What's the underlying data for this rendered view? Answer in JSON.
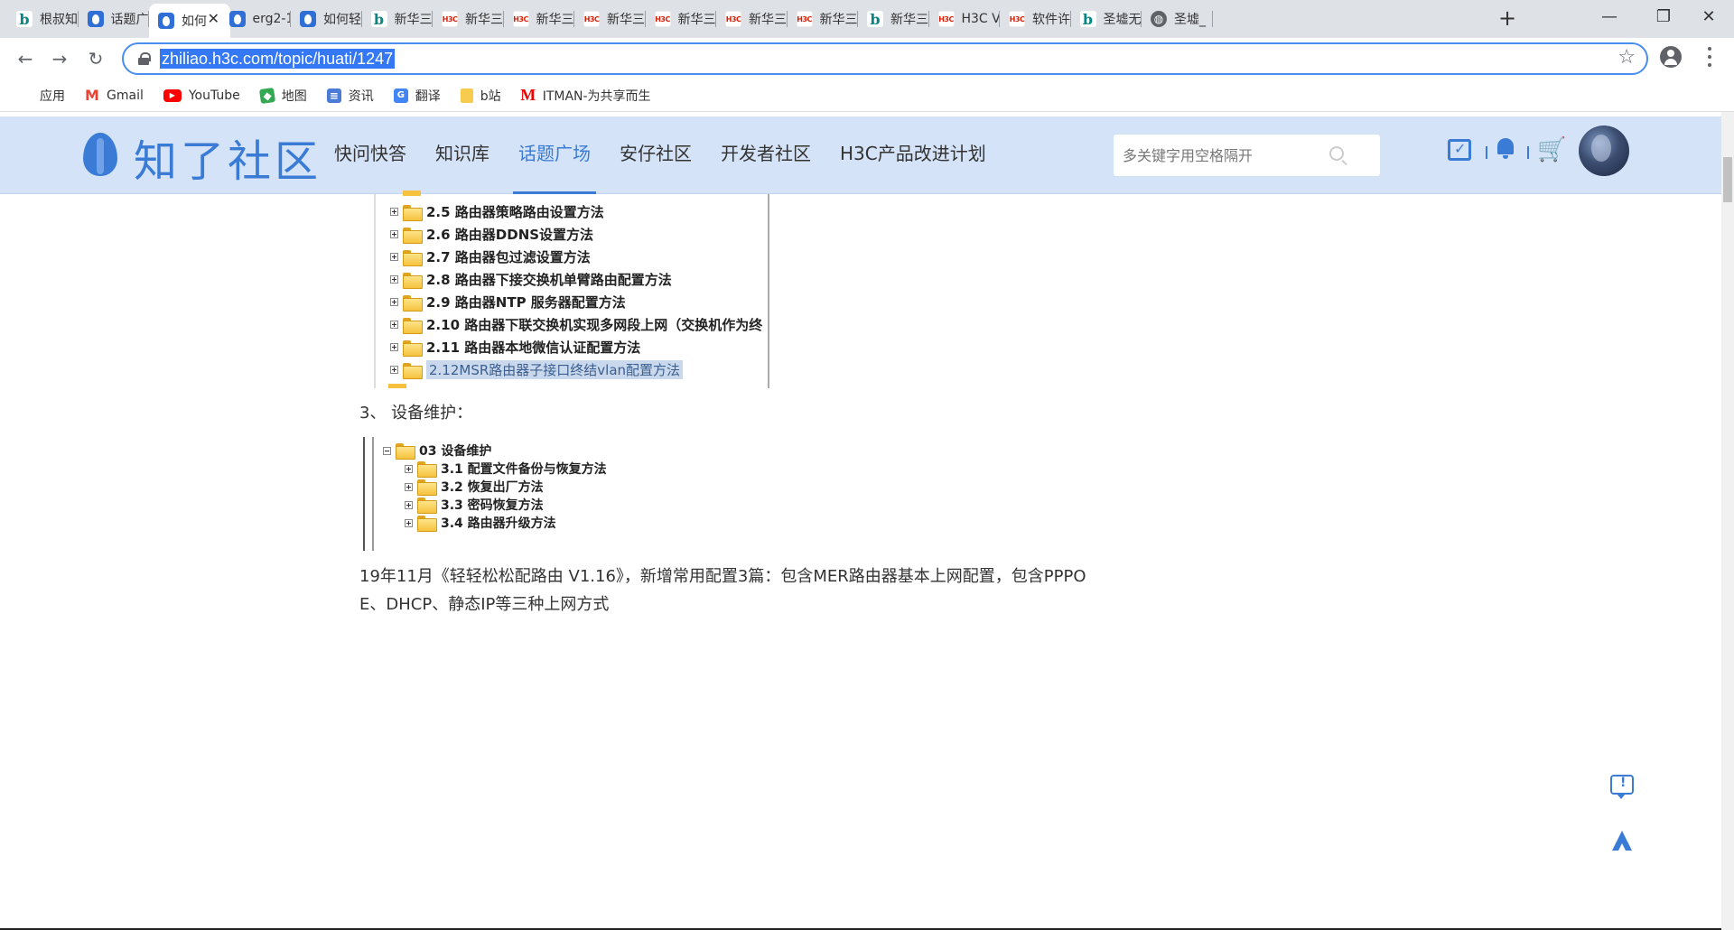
{
  "browser": {
    "tabs": [
      {
        "title": "根叔知",
        "favicon": "bing"
      },
      {
        "title": "话题广",
        "favicon": "zhiliao"
      },
      {
        "title": "如何",
        "favicon": "zhiliao",
        "active": true
      },
      {
        "title": "erg2-1",
        "favicon": "zhiliao"
      },
      {
        "title": "如何轻",
        "favicon": "zhiliao"
      },
      {
        "title": "新华三",
        "favicon": "bing"
      },
      {
        "title": "新华三",
        "favicon": "h3c"
      },
      {
        "title": "新华三",
        "favicon": "h3c"
      },
      {
        "title": "新华三",
        "favicon": "h3c"
      },
      {
        "title": "新华三",
        "favicon": "h3c"
      },
      {
        "title": "新华三",
        "favicon": "h3c"
      },
      {
        "title": "新华三",
        "favicon": "h3c"
      },
      {
        "title": "新华三",
        "favicon": "bing"
      },
      {
        "title": "H3C V",
        "favicon": "h3c"
      },
      {
        "title": "软件许",
        "favicon": "h3c"
      },
      {
        "title": "圣墟无",
        "favicon": "bing"
      },
      {
        "title": "圣墟_",
        "favicon": "globe"
      }
    ],
    "new_tab_label": "+",
    "url": "zhiliao.h3c.com/topic/huati/1247",
    "bookmarks": [
      {
        "label": "应用",
        "icon": "apps-grid-icon"
      },
      {
        "label": "Gmail",
        "icon": "gmail-icon"
      },
      {
        "label": "YouTube",
        "icon": "youtube-icon"
      },
      {
        "label": "地图",
        "icon": "maps-icon"
      },
      {
        "label": "资讯",
        "icon": "news-icon"
      },
      {
        "label": "翻译",
        "icon": "translate-icon"
      },
      {
        "label": "b站",
        "icon": "folder-icon"
      },
      {
        "label": "ITMAN-为共享而生",
        "icon": "itman-icon"
      }
    ]
  },
  "site": {
    "logo_text": "知了社区",
    "nav": [
      "快问快答",
      "知识库",
      "话题广场",
      "安仔社区",
      "开发者社区",
      "H3C产品改进计划"
    ],
    "active_nav_index": 2,
    "search_placeholder": "多关键字用空格隔开",
    "accent_color": "#3a7bd5",
    "header_bg": "#d4e3f7"
  },
  "content": {
    "tree1": {
      "items": [
        "2.5 路由器策略路由设置方法",
        "2.6 路由器DDNS设置方法",
        "2.7 路由器包过滤设置方法",
        "2.8 路由器下接交换机单臂路由配置方法",
        "2.9 路由器NTP 服务器配置方法",
        "2.10 路由器下联交换机实现多网段上网（交换机作为终",
        "2.11 路由器本地微信认证配置方法",
        "2.12MSR路由器子接口终结vlan配置方法"
      ],
      "highlight_index": 7
    },
    "section3_title": "3、   设备维护：",
    "tree2": {
      "root": "03 设备维护",
      "items": [
        "3.1 配置文件备份与恢复方法",
        "3.2 恢复出厂方法",
        "3.3 密码恢复方法",
        "3.4 路由器升级方法"
      ]
    },
    "paragraph_line1": "19年11月《轻轻松松配路由 V1.16》，新增常用配置3篇：包含MER路由器基本上网配置，包含PPPO",
    "paragraph_line2": "E、DHCP、静态IP等三种上网方式"
  }
}
